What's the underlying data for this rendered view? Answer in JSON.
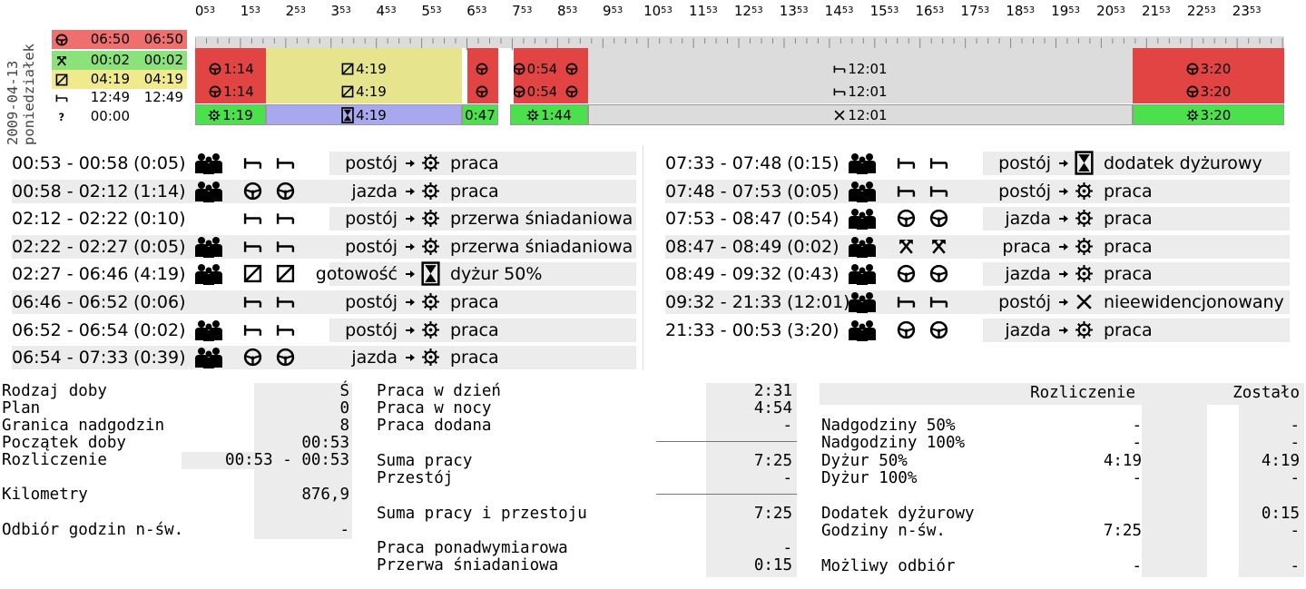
{
  "date": "2009-04-13",
  "weekday": "poniedziałek",
  "legend": [
    {
      "icon": "steering-wheel-icon",
      "a": "06:50",
      "b": "06:50",
      "color": "#ef6e6e"
    },
    {
      "icon": "hammers-icon",
      "a": "00:02",
      "b": "00:02",
      "color": "#8ce27a"
    },
    {
      "icon": "availability-icon",
      "a": "04:19",
      "b": "04:19",
      "color": "#f0ea8c"
    },
    {
      "icon": "bed-icon",
      "a": "12:49",
      "b": "12:49",
      "color": ""
    },
    {
      "icon": "question-icon",
      "a": "00:00",
      "b": "",
      "color": ""
    }
  ],
  "hours": [
    "0",
    "1",
    "2",
    "3",
    "4",
    "5",
    "6",
    "7",
    "8",
    "9",
    "10",
    "11",
    "12",
    "13",
    "14",
    "15",
    "16",
    "17",
    "18",
    "19",
    "20",
    "21",
    "22",
    "23"
  ],
  "hour_sup": "53",
  "timeline": {
    "upper": [
      {
        "icon": "steering-wheel-icon",
        "t1": "1:14",
        "t2": "1:14",
        "color": "#e24444"
      },
      {
        "icon": "availability-icon",
        "t1": "4:19",
        "t2": "4:19",
        "color": "#e6e48c"
      },
      {
        "icon": "steering-wheel-icon",
        "t1": "",
        "t2": "",
        "color": "#e24444"
      },
      {
        "icon": "steering-wheel-icon",
        "t1": "0:54",
        "t2": "0:54",
        "color": "#e24444"
      },
      {
        "icon": "steering-wheel-icon",
        "t1": "",
        "t2": "",
        "color": "#e24444"
      },
      {
        "icon": "bed-icon",
        "t1": "12:01",
        "t2": "12:01",
        "color": "#dcdcdc"
      },
      {
        "icon": "steering-wheel-icon",
        "t1": "3:20",
        "t2": "3:20",
        "color": "#e24444"
      }
    ],
    "lower": [
      {
        "icon": "wheel-icon",
        "t": "1:19",
        "color": "#4de04d"
      },
      {
        "icon": "hourglass-icon",
        "t": "4:19",
        "color": "#a8a8ee"
      },
      {
        "icon": "",
        "t": "0:47",
        "color": "#4de04d"
      },
      {
        "icon": "wheel-icon",
        "t": "1:44",
        "color": "#4de04d"
      },
      {
        "icon": "cross-icon",
        "t": "12:01",
        "color": "#dcdcdc"
      },
      {
        "icon": "wheel-icon",
        "t": "3:20",
        "color": "#4de04d"
      }
    ]
  },
  "events_left": [
    {
      "range": "00:53 - 00:58",
      "dur": "(0:05)",
      "crew": true,
      "i1": "bed-icon",
      "i2": "bed-icon",
      "act": "postój",
      "ri": "wheel-icon",
      "res": "praca"
    },
    {
      "range": "00:58 - 02:12",
      "dur": "(1:14)",
      "crew": true,
      "i1": "steering-wheel-icon",
      "i2": "steering-wheel-icon",
      "act": "jazda",
      "ri": "wheel-icon",
      "res": "praca"
    },
    {
      "range": "02:12 - 02:22",
      "dur": "(0:10)",
      "crew": false,
      "i1": "bed-icon",
      "i2": "bed-icon",
      "act": "postój",
      "ri": "wheel-icon",
      "res": "przerwa śniadaniowa"
    },
    {
      "range": "02:22 - 02:27",
      "dur": "(0:05)",
      "crew": true,
      "i1": "bed-icon",
      "i2": "bed-icon",
      "act": "postój",
      "ri": "wheel-icon",
      "res": "przerwa śniadaniowa"
    },
    {
      "range": "02:27 - 06:46",
      "dur": "(4:19)",
      "crew": true,
      "i1": "availability-icon",
      "i2": "availability-icon",
      "act": "gotowość",
      "ri": "hourglass-icon",
      "res": "dyżur 50%"
    },
    {
      "range": "06:46 - 06:52",
      "dur": "(0:06)",
      "crew": false,
      "i1": "bed-icon",
      "i2": "bed-icon",
      "act": "postój",
      "ri": "wheel-icon",
      "res": "praca"
    },
    {
      "range": "06:52 - 06:54",
      "dur": "(0:02)",
      "crew": true,
      "i1": "bed-icon",
      "i2": "bed-icon",
      "act": "postój",
      "ri": "wheel-icon",
      "res": "praca"
    },
    {
      "range": "06:54 - 07:33",
      "dur": "(0:39)",
      "crew": true,
      "i1": "steering-wheel-icon",
      "i2": "steering-wheel-icon",
      "act": "jazda",
      "ri": "wheel-icon",
      "res": "praca"
    }
  ],
  "events_right": [
    {
      "range": "07:33 - 07:48",
      "dur": "(0:15)",
      "crew": true,
      "i1": "bed-icon",
      "i2": "bed-icon",
      "act": "postój",
      "ri": "hourglass-icon",
      "res": "dodatek dyżurowy"
    },
    {
      "range": "07:48 - 07:53",
      "dur": "(0:05)",
      "crew": true,
      "i1": "bed-icon",
      "i2": "bed-icon",
      "act": "postój",
      "ri": "wheel-icon",
      "res": "praca"
    },
    {
      "range": "07:53 - 08:47",
      "dur": "(0:54)",
      "crew": true,
      "i1": "steering-wheel-icon",
      "i2": "steering-wheel-icon",
      "act": "jazda",
      "ri": "wheel-icon",
      "res": "praca"
    },
    {
      "range": "08:47 - 08:49",
      "dur": "(0:02)",
      "crew": true,
      "i1": "hammers-icon",
      "i2": "hammers-icon",
      "act": "praca",
      "ri": "wheel-icon",
      "res": "praca"
    },
    {
      "range": "08:49 - 09:32",
      "dur": "(0:43)",
      "crew": true,
      "i1": "steering-wheel-icon",
      "i2": "steering-wheel-icon",
      "act": "jazda",
      "ri": "wheel-icon",
      "res": "praca"
    },
    {
      "range": "09:32 - 21:33",
      "dur": "(12:01)",
      "crew": true,
      "i1": "bed-icon",
      "i2": "bed-icon",
      "act": "postój",
      "ri": "cross-icon",
      "res": "nieewidencjonowany"
    },
    {
      "range": "21:33 - 00:53",
      "dur": "(3:20)",
      "crew": true,
      "i1": "steering-wheel-icon",
      "i2": "steering-wheel-icon",
      "act": "jazda",
      "ri": "wheel-icon",
      "res": "praca"
    }
  ],
  "stats_left": {
    "rodzaj_label": "Rodzaj doby",
    "rodzaj_val": "Ś",
    "plan_label": "Plan",
    "plan_val": "0",
    "granica_label": "Granica nadgodzin",
    "granica_val": "8",
    "poczatek_label": "Początek doby",
    "poczatek_val": "00:53",
    "rozl_label": "Rozliczenie",
    "rozl_val": "00:53 - 00:53",
    "km_label": "Kilometry",
    "km_val": "876,9",
    "odbior_label": "Odbiór godzin n-św.",
    "odbior_val": "-"
  },
  "stats_mid": {
    "praca_dzien_label": "Praca w dzień",
    "praca_dzien_val": "2:31",
    "praca_noc_label": "Praca w nocy",
    "praca_noc_val": "4:54",
    "praca_dodana_label": "Praca dodana",
    "praca_dodana_val": "-",
    "suma_pracy_label": "Suma pracy",
    "suma_pracy_val": "7:25",
    "przestoj_label": "Przestój",
    "przestoj_val": "-",
    "suma_pp_label": "Suma pracy i przestoju",
    "suma_pp_val": "7:25",
    "ponad_label": "Praca ponadwymiarowa",
    "ponad_val": "-",
    "przerwa_label": "Przerwa śniadaniowa",
    "przerwa_val": "0:15"
  },
  "stats_right": {
    "col1": "Rozliczenie",
    "col2": "Zostało",
    "rows": [
      {
        "label": "Nadgodziny 50%",
        "a": "-",
        "b": "-"
      },
      {
        "label": "Nadgodziny 100%",
        "a": "-",
        "b": "-"
      },
      {
        "label": "Dyżur 50%",
        "a": "4:19",
        "b": "4:19"
      },
      {
        "label": "Dyżur 100%",
        "a": "-",
        "b": "-"
      },
      {
        "label": "Dodatek dyżurowy",
        "a": "",
        "b": "0:15"
      },
      {
        "label": "Godziny n-św.",
        "a": "7:25",
        "b": "-"
      },
      {
        "label": "Możliwy odbiór",
        "a": "-",
        "b": "-"
      }
    ]
  }
}
